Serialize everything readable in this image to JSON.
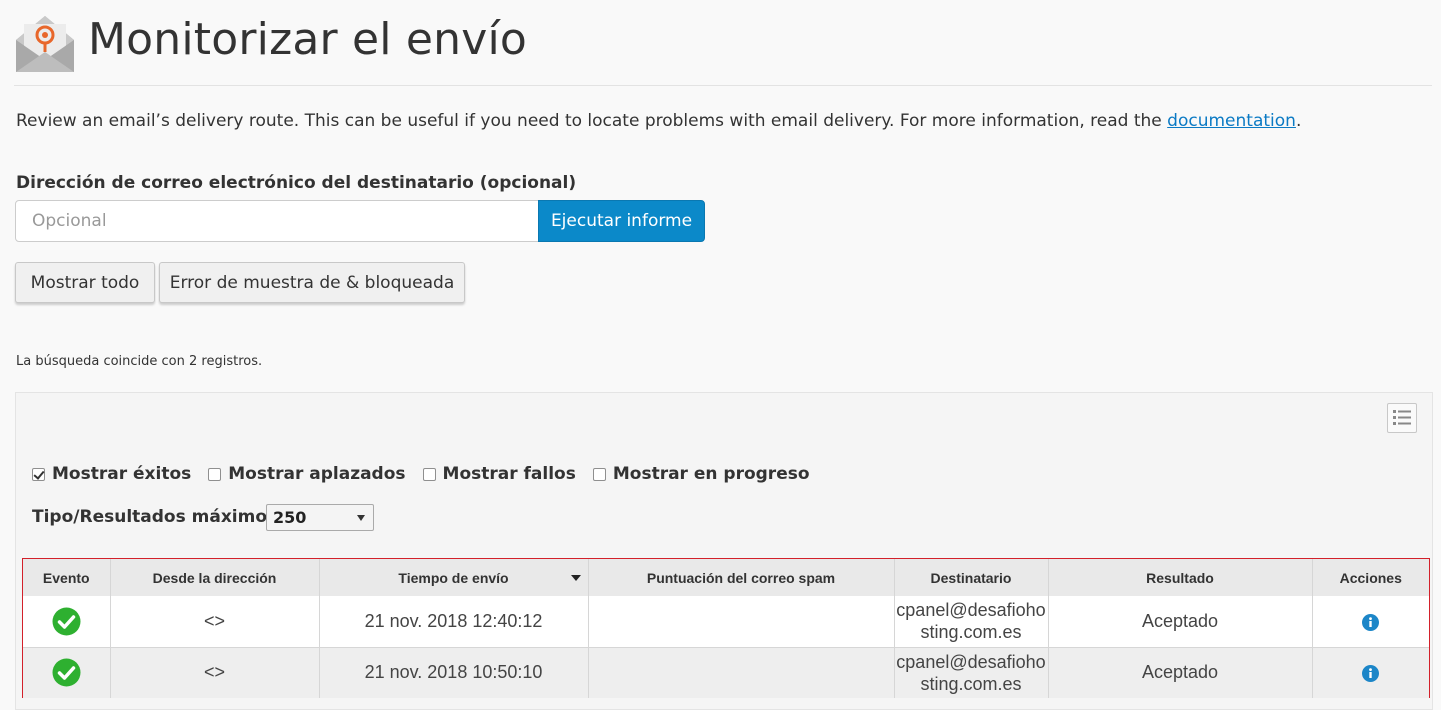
{
  "header": {
    "title": "Monitorizar el envío",
    "icon": "envelope-location-icon"
  },
  "intro": {
    "text": "Review an email’s delivery route. This can be useful if you need to locate problems with email delivery. For more information, read the ",
    "link": "documentation",
    "suffix": "."
  },
  "form": {
    "label": "Dirección de correo electrónico del destinatario (opcional)",
    "placeholder": "Opcional",
    "value": "",
    "run_button": "Ejecutar informe",
    "show_all_button": "Mostrar todo",
    "show_errors_button": "Error de muestra de & bloqueada"
  },
  "results": {
    "count_text": "La búsqueda coincide con 2 registros."
  },
  "filters": [
    {
      "label": "Mostrar éxitos",
      "checked": true
    },
    {
      "label": "Mostrar aplazados",
      "checked": false
    },
    {
      "label": "Mostrar fallos",
      "checked": false
    },
    {
      "label": "Mostrar en progreso",
      "checked": false
    }
  ],
  "max_results": {
    "label": "Tipo/Resultados máximos:",
    "value": "250"
  },
  "table": {
    "columns": [
      "Evento",
      "Desde la dirección",
      "Tiempo de envío",
      "Puntuación del correo spam",
      "Destinatario",
      "Resultado",
      "Acciones"
    ],
    "sorted_column": "Tiempo de envío",
    "rows": [
      {
        "event": "success-icon",
        "from": "<>",
        "time": "21 nov. 2018 12:40:12",
        "spam": "",
        "recipient_line1": "cpanel@desafioho",
        "recipient_line2": "sting.com.es",
        "result": "Aceptado",
        "action": "info-icon"
      },
      {
        "event": "success-icon",
        "from": "<>",
        "time": "21 nov. 2018 10:50:10",
        "spam": "",
        "recipient_line1": "cpanel@desafioho",
        "recipient_line2": "sting.com.es",
        "result": "Aceptado",
        "action": "info-icon"
      }
    ]
  },
  "colors": {
    "accent": "#0b89c9",
    "link": "#0b7ac4",
    "success": "#2eb030",
    "highlight_border": "#d3202a",
    "icon_orange": "#e8672b"
  }
}
